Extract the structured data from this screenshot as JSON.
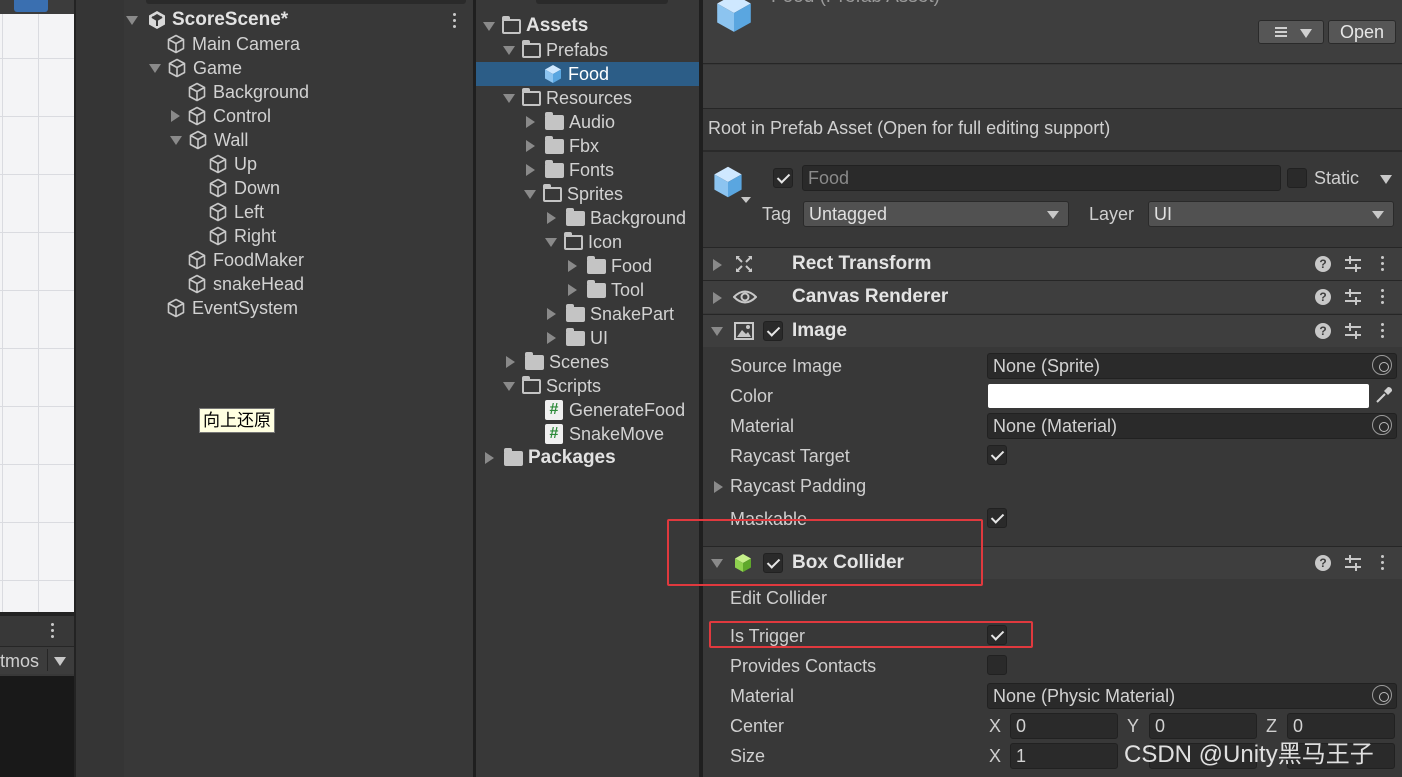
{
  "hierarchy": {
    "scene_name": "ScoreScene*",
    "items": [
      {
        "label": "Main Camera"
      },
      {
        "label": "Game"
      },
      {
        "label": "Background"
      },
      {
        "label": "Control"
      },
      {
        "label": "Wall"
      },
      {
        "label": "Up"
      },
      {
        "label": "Down"
      },
      {
        "label": "Left"
      },
      {
        "label": "Right"
      },
      {
        "label": "FoodMaker"
      },
      {
        "label": "snakeHead"
      },
      {
        "label": "EventSystem"
      }
    ],
    "tooltip": "向上还原"
  },
  "scene_toolbar": {
    "gizmos_label": "tmos"
  },
  "project": {
    "items": [
      {
        "label": "Assets"
      },
      {
        "label": "Prefabs"
      },
      {
        "label": "Food"
      },
      {
        "label": "Resources"
      },
      {
        "label": "Audio"
      },
      {
        "label": "Fbx"
      },
      {
        "label": "Fonts"
      },
      {
        "label": "Sprites"
      },
      {
        "label": "Background"
      },
      {
        "label": "Icon"
      },
      {
        "label": "Food"
      },
      {
        "label": "Tool"
      },
      {
        "label": "SnakePart"
      },
      {
        "label": "UI"
      },
      {
        "label": "Scenes"
      },
      {
        "label": "Scripts"
      },
      {
        "label": "GenerateFood"
      },
      {
        "label": "SnakeMove"
      },
      {
        "label": "Packages"
      }
    ]
  },
  "inspector": {
    "header_title": "Food (Prefab Asset)",
    "open_button": "Open",
    "root_notice": "Root in Prefab Asset (Open for full editing support)",
    "object_name": "Food",
    "static_label": "Static",
    "tag_label": "Tag",
    "tag_value": "Untagged",
    "layer_label": "Layer",
    "layer_value": "UI",
    "components": {
      "rect_transform": "Rect Transform",
      "canvas_renderer": "Canvas Renderer",
      "image": "Image",
      "box_collider": "Box Collider"
    },
    "image_props": {
      "source_image_label": "Source Image",
      "source_image_value": "None (Sprite)",
      "color_label": "Color",
      "material_label": "Material",
      "material_value": "None (Material)",
      "raycast_target_label": "Raycast Target",
      "raycast_padding_label": "Raycast Padding",
      "maskable_label": "Maskable"
    },
    "collider_props": {
      "edit_collider_label": "Edit Collider",
      "is_trigger_label": "Is Trigger",
      "provides_contacts_label": "Provides Contacts",
      "material_label": "Material",
      "material_value": "None (Physic Material)",
      "center_label": "Center",
      "center": {
        "x_label": "X",
        "x": "0",
        "y_label": "Y",
        "y": "0",
        "z_label": "Z",
        "z": "0"
      },
      "size_label": "Size",
      "size": {
        "x_label": "X",
        "x": "1"
      }
    },
    "help_glyph": "?",
    "script_glyph": "#"
  },
  "watermark": "CSDN @Unity黑马王子",
  "colors": {
    "highlight": "#e0393e",
    "selection": "#2c5d87",
    "collider_icon": "#8fd14f"
  }
}
